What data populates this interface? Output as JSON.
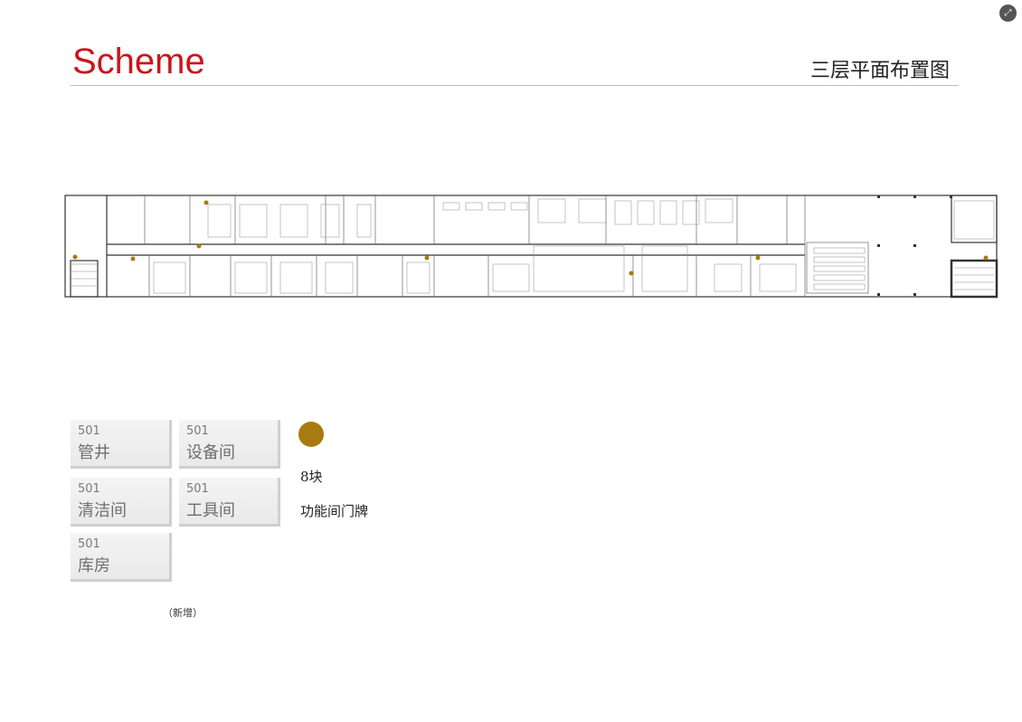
{
  "header": {
    "title": "Scheme",
    "subtitle": "三层平面布置图"
  },
  "colors": {
    "accent": "#c9161d",
    "marker": "#a87a10"
  },
  "signs": [
    {
      "number": "501",
      "name": "管井"
    },
    {
      "number": "501",
      "name": "设备间"
    },
    {
      "number": "501",
      "name": "清洁间"
    },
    {
      "number": "501",
      "name": "工具间"
    },
    {
      "number": "501",
      "name": "库房"
    }
  ],
  "added_note": "（新增）",
  "legend": {
    "count": "8块",
    "description": "功能间门牌"
  }
}
